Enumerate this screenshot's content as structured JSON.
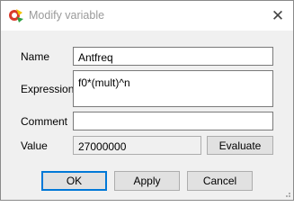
{
  "window": {
    "title": "Modify variable",
    "close_glyph": "✕"
  },
  "form": {
    "name_label": "Name",
    "name_value": "Antfreq",
    "expression_label": "Expression",
    "expression_value": "f0*(mult)^n",
    "comment_label": "Comment",
    "comment_value": "",
    "value_label": "Value",
    "value_value": "27000000",
    "evaluate_label": "Evaluate"
  },
  "buttons": {
    "ok_label": "OK",
    "apply_label": "Apply",
    "cancel_label": "Cancel"
  },
  "colors": {
    "default_button_border": "#0078d7",
    "window_background": "#f0f0f0"
  }
}
